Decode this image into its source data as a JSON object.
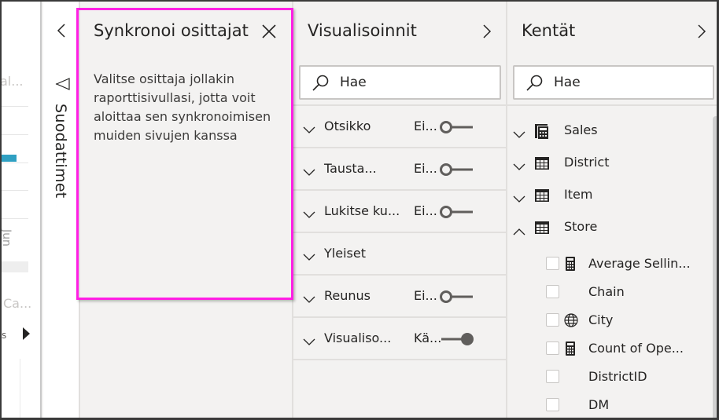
{
  "report_canvas": {
    "fragments": [
      "al...",
      "Jun",
      "Ca...",
      "s"
    ],
    "accent_color": "#2fa0c2"
  },
  "filters_pane": {
    "label": "Suodattimet",
    "expand_icon": "chevron-left-icon",
    "filter_icon": "funnel-icon"
  },
  "sync_slicers_pane": {
    "title": "Synkronoi osittajat",
    "close_icon": "close-icon",
    "description": "Valitse osittaja jollakin raporttisivullasi, jotta voit aloittaa sen synkronoimisen muiden sivujen kanssa",
    "highlight_color": "#ff1fe4"
  },
  "visualizations_pane": {
    "title": "Visualisoinnit",
    "collapse_icon": "chevron-right-icon",
    "search": {
      "placeholder": "Hae",
      "value": ""
    },
    "sections": [
      {
        "label": "Otsikko",
        "state": "Ei...",
        "toggle_on": false,
        "has_toggle": true
      },
      {
        "label": "Tausta...",
        "state": "Ei...",
        "toggle_on": false,
        "has_toggle": true
      },
      {
        "label": "Lukitse ku...",
        "state": "Ei...",
        "toggle_on": false,
        "has_toggle": true
      },
      {
        "label": "Yleiset",
        "state": "",
        "toggle_on": false,
        "has_toggle": false
      },
      {
        "label": "Reunus",
        "state": "Ei...",
        "toggle_on": false,
        "has_toggle": true
      },
      {
        "label": "Visualiso...",
        "state": "Kä...",
        "toggle_on": true,
        "has_toggle": true
      }
    ]
  },
  "fields_pane": {
    "title": "Kentät",
    "collapse_icon": "chevron-right-icon",
    "search": {
      "placeholder": "Hae",
      "value": ""
    },
    "tables": [
      {
        "name": "Sales",
        "icon": "calculator-table-icon",
        "expanded": false
      },
      {
        "name": "District",
        "icon": "table-icon",
        "expanded": false
      },
      {
        "name": "Item",
        "icon": "table-icon",
        "expanded": false
      },
      {
        "name": "Store",
        "icon": "table-icon",
        "expanded": true
      }
    ],
    "store_fields": [
      {
        "name": "Average Sellin...",
        "icon": "calculator-icon",
        "checked": false
      },
      {
        "name": "Chain",
        "icon": "",
        "checked": false
      },
      {
        "name": "City",
        "icon": "globe-icon",
        "checked": false
      },
      {
        "name": "Count of Ope...",
        "icon": "calculator-icon",
        "checked": false
      },
      {
        "name": "DistrictID",
        "icon": "",
        "checked": false
      },
      {
        "name": "DM",
        "icon": "",
        "checked": false
      }
    ]
  }
}
